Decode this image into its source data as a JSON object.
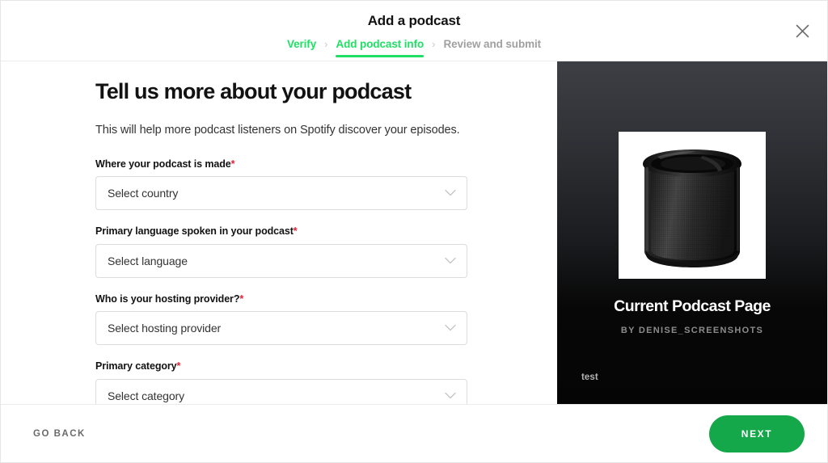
{
  "header": {
    "title": "Add a podcast",
    "close_icon": "close-icon",
    "separator": "›",
    "steps": [
      {
        "label": "Verify",
        "state": "done"
      },
      {
        "label": "Add podcast info",
        "state": "current"
      },
      {
        "label": "Review and submit",
        "state": "upcoming"
      }
    ]
  },
  "form": {
    "heading": "Tell us more about your podcast",
    "subtitle": "This will help more podcast listeners on Spotify discover your episodes.",
    "required_marker": "*",
    "fields": [
      {
        "label": "Where your podcast is made",
        "required": true,
        "value": "Select country",
        "placeholder": "Select country",
        "icon": "chevron-down-icon"
      },
      {
        "label": "Primary language spoken in your podcast",
        "required": true,
        "value": "Select language",
        "placeholder": "Select language",
        "icon": "chevron-down-icon"
      },
      {
        "label": "Who is your hosting provider?",
        "required": true,
        "value": "Select hosting provider",
        "placeholder": "Select hosting provider",
        "icon": "chevron-down-icon"
      },
      {
        "label": "Primary category",
        "required": true,
        "value": "Select category",
        "placeholder": "Select category",
        "icon": "chevron-down-icon"
      }
    ]
  },
  "preview": {
    "cover_alt": "Black pop filter microphone shield on white background",
    "title": "Current Podcast Page",
    "author": "BY DENISE_SCREENSHOTS",
    "description": "test"
  },
  "footer": {
    "back_label": "GO BACK",
    "next_label": "NEXT"
  },
  "colors": {
    "brand_green": "#1fe065",
    "button_green": "#14a84a",
    "required_red": "#e22134",
    "text_primary": "#121212",
    "text_muted": "#a0a0a0",
    "border": "#dcdcdc",
    "preview_bg_top": "#3d3f45",
    "preview_bg_bottom": "#050505"
  }
}
